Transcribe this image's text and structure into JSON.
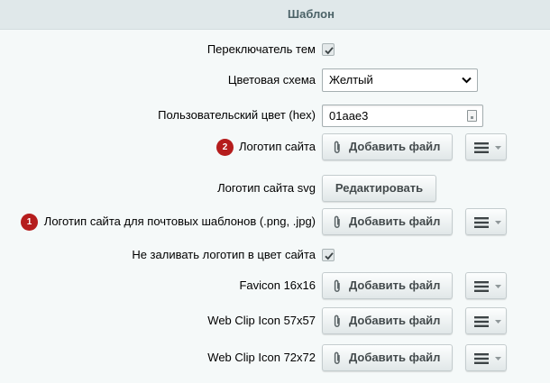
{
  "section": {
    "title": "Шаблон"
  },
  "rows": {
    "theme_switcher": {
      "label": "Переключатель тем",
      "checked": true
    },
    "color_scheme": {
      "label": "Цветовая схема",
      "value": "Желтый"
    },
    "custom_color": {
      "label": "Пользовательский цвет (hex)",
      "value": "01aae3"
    },
    "site_logo": {
      "label": "Логотип сайта",
      "badge": "2",
      "button": "Добавить файл"
    },
    "site_logo_svg": {
      "label": "Логотип сайта svg",
      "button": "Редактировать"
    },
    "mail_logo": {
      "label": "Логотип сайта для почтовых шаблонов (.png, .jpg)",
      "badge": "1",
      "button": "Добавить файл"
    },
    "no_fill_logo": {
      "label": "Не заливать логотип в цвет сайта",
      "checked": true
    },
    "favicon": {
      "label": "Favicon 16x16",
      "button": "Добавить файл"
    },
    "webclip57": {
      "label": "Web Clip Icon 57x57",
      "button": "Добавить файл"
    },
    "webclip72": {
      "label": "Web Clip Icon 72x72",
      "button": "Добавить файл"
    }
  },
  "icons": {
    "check": "check-icon",
    "clip": "paperclip-icon",
    "menu": "hamburger-menu-icon",
    "caret": "caret-down-icon",
    "picker": "color-picker-icon"
  },
  "colors": {
    "badge": "#b51d1d",
    "header_bg": "#e0e8ea",
    "header_text": "#4b6267",
    "page_bg": "#f5f9f9"
  }
}
